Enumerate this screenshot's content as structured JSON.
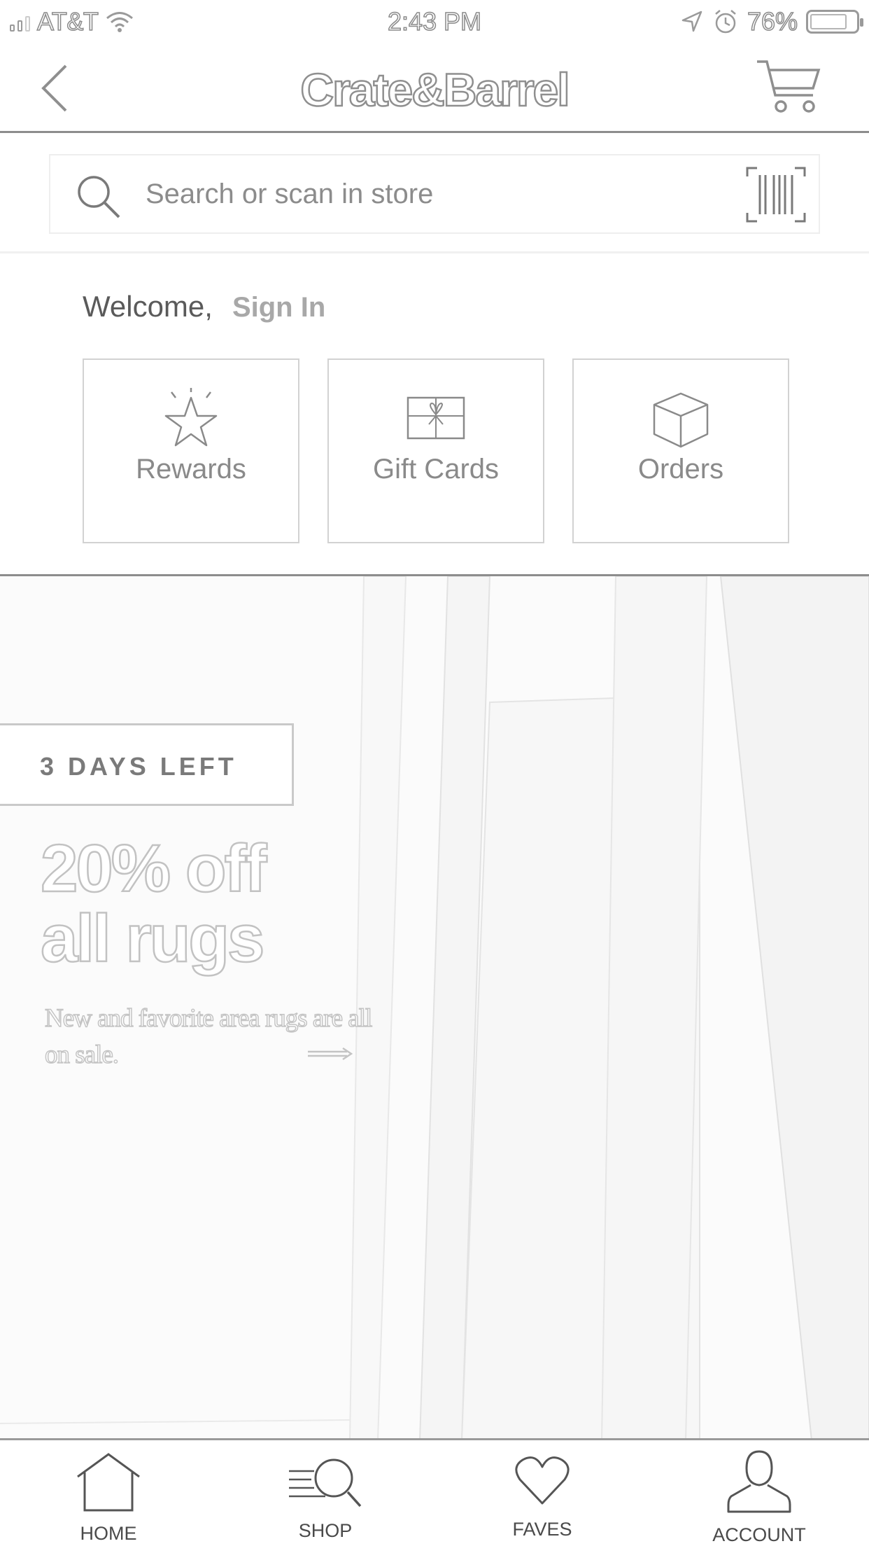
{
  "status_bar": {
    "carrier": "AT&T",
    "time": "2:43 PM",
    "battery_percent": "76%",
    "icons": [
      "signal-icon",
      "wifi-icon",
      "location-icon",
      "alarm-icon",
      "battery-icon"
    ]
  },
  "header": {
    "logo": "Crate&Barrel",
    "back_icon": "chevron-left-icon",
    "cart_icon": "cart-icon"
  },
  "search": {
    "placeholder": "Search or scan in store",
    "icon": "search-icon",
    "scan_icon": "barcode-icon"
  },
  "welcome": {
    "label": "Welcome,",
    "sign_in": "Sign In"
  },
  "quick_links": [
    {
      "label": "Rewards",
      "icon": "star-icon"
    },
    {
      "label": "Gift Cards",
      "icon": "gift-card-icon"
    },
    {
      "label": "Orders",
      "icon": "box-icon"
    }
  ],
  "promo": {
    "badge": "3 DAYS LEFT",
    "headline": "20% off\nall rugs",
    "subtext": "New and favorite area rugs are all on sale.",
    "arrow_icon": "arrow-right-icon"
  },
  "tabbar": [
    {
      "label": "HOME",
      "icon": "home-icon"
    },
    {
      "label": "SHOP",
      "icon": "shop-search-icon"
    },
    {
      "label": "FAVES",
      "icon": "heart-icon"
    },
    {
      "label": "ACCOUNT",
      "icon": "person-icon"
    }
  ]
}
